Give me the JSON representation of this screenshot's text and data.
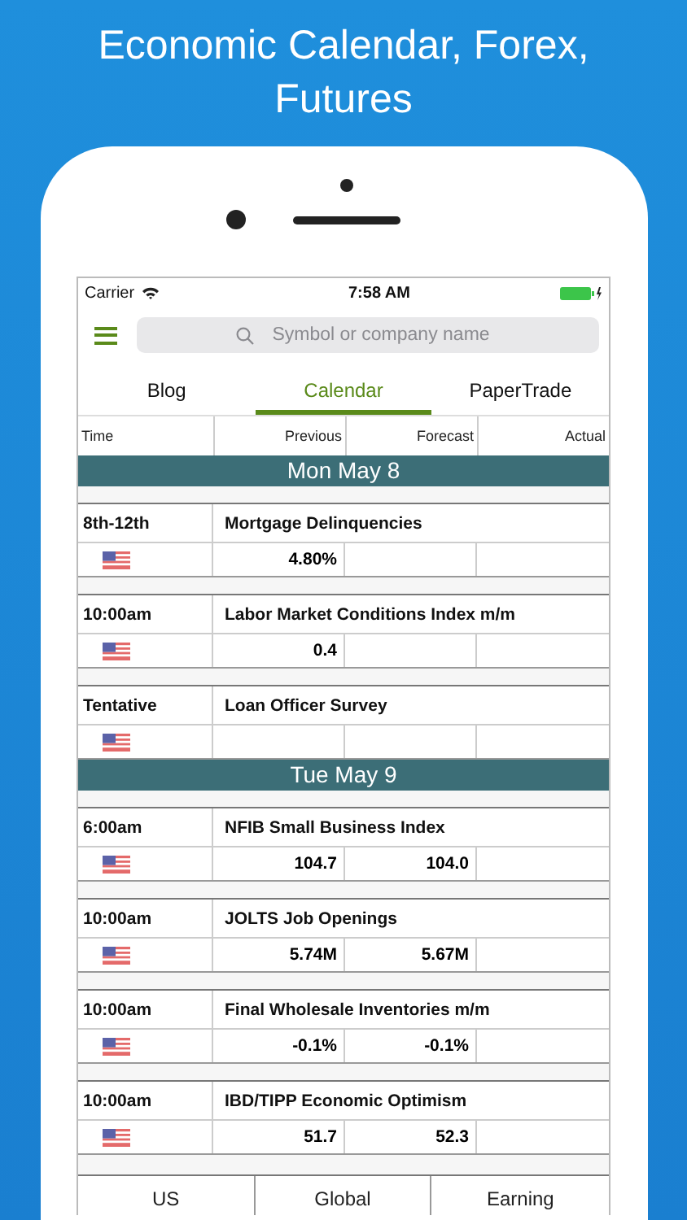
{
  "headline": "Economic Calendar, Forex, Futures",
  "status_bar": {
    "carrier": "Carrier",
    "time": "7:58 AM"
  },
  "search": {
    "placeholder": "Symbol or company name"
  },
  "tabs": [
    {
      "label": "Blog",
      "selected": false
    },
    {
      "label": "Calendar",
      "selected": true
    },
    {
      "label": "PaperTrade",
      "selected": false
    }
  ],
  "table": {
    "columns": [
      "Time",
      "Previous",
      "Forecast",
      "Actual"
    ]
  },
  "days": [
    {
      "title": "Mon May 8",
      "events": [
        {
          "time": "8th-12th",
          "name": "Mortgage Delinquencies",
          "previous": "4.80%"
        },
        {
          "time": "10:00am",
          "name": "Labor Market Conditions Index m/m",
          "previous": "0.4"
        },
        {
          "time": "Tentative",
          "name": "Loan Officer Survey"
        }
      ]
    },
    {
      "title": "Tue May 9",
      "events": [
        {
          "time": "6:00am",
          "name": "NFIB Small Business Index",
          "previous": "104.7",
          "forecast": "104.0"
        },
        {
          "time": "10:00am",
          "name": "JOLTS Job Openings",
          "previous": "5.74M",
          "forecast": "5.67M"
        },
        {
          "time": "10:00am",
          "name": "Final Wholesale Inventories m/m",
          "previous": "-0.1%",
          "forecast": "-0.1%"
        },
        {
          "time": "10:00am",
          "name": "IBD/TIPP Economic Optimism",
          "previous": "51.7",
          "forecast": "52.3"
        }
      ]
    }
  ],
  "bottom_tabs": [
    "US",
    "Global",
    "Earning"
  ]
}
